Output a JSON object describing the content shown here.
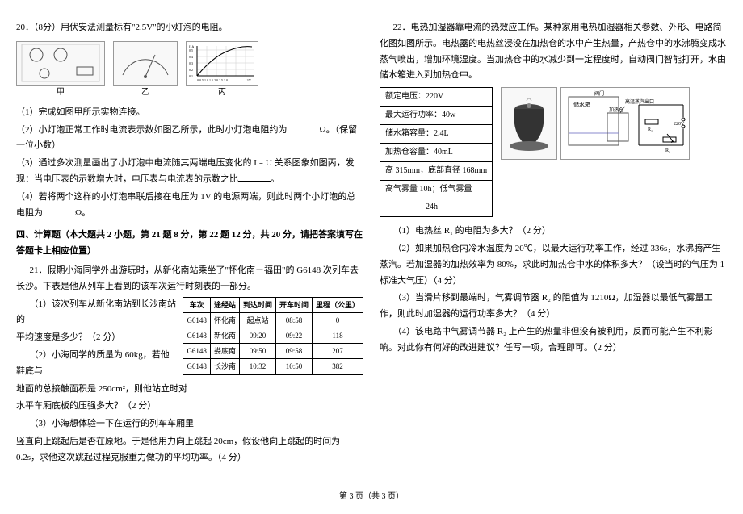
{
  "q20": {
    "title": "20．（8分）用伏安法测量标有\"2.5V\"的小灯泡的电阻。",
    "fig_labels": [
      "甲",
      "乙",
      "丙"
    ],
    "s1": "（1）完成如图甲所示实物连接。",
    "s2": "（2）小灯泡正常工作时电流表示数如图乙所示，此时小灯泡电阻约为",
    "s2_tail": "Ω。（保留一位小数）",
    "s3": "（3）通过多次测量画出了小灯泡中电流随其两端电压变化的 I﹣U 关系图象如图丙，发现：当电压表的示数增大时，电压表与电流表的示数之比",
    "s3_tail": "。",
    "s4": "（4）若将两个这样的小灯泡串联后接在电压为 1V 的电源两端，则此时两个小灯泡的总电阻为",
    "s4_tail": "Ω。"
  },
  "section4": "四、计算题（本大题共 2 小题，第 21 题 8 分，第 22 题 12 分，共 20 分，请把答案填写在答题卡上相应位置）",
  "q21": {
    "intro": "21．假期小海同学外出游玩时，从新化南站乘坐了\"怀化南－福田\"的 G6148 次列车去长沙。下表是他从列车上看到的该车次运行时刻表的一部分。",
    "s1a": "（1）该次列车从新化南站到长沙南站的",
    "s1b": "平均速度是多少？（2 分）",
    "s2a": "（2）小海同学的质量为 60kg，若他鞋底与",
    "s2b": "地面的总接触面积是 250cm²，则他站立时对",
    "s2c": "水平车厢底板的压强多大？（2 分）",
    "s3a": "（3）小海想体验一下在运行的列车车厢里",
    "s3b": "竖直向上跳起后是否在原地。于是他用力向上跳起 20cm，假设他向上跳起的时间为 0.2s，求他这次跳起过程克服重力做功的平均功率。（4 分）",
    "table": {
      "headers": [
        "车次",
        "途经站",
        "到达时间",
        "开车时间",
        "里程（公里）"
      ],
      "rows": [
        [
          "G6148",
          "怀化南",
          "起点站",
          "08:58",
          "0"
        ],
        [
          "G6148",
          "新化南",
          "09:20",
          "09:22",
          "118"
        ],
        [
          "G6148",
          "娄底南",
          "09:50",
          "09:58",
          "207"
        ],
        [
          "G6148",
          "长沙南",
          "10:32",
          "10:50",
          "382"
        ]
      ]
    }
  },
  "q22": {
    "intro": "22．电热加湿器靠电流的热效应工作。某种家用电热加湿器相关参数、外形、电路简化图如图所示。电热器的电热丝浸没在加热仓的水中产生热量，产热仓中的水沸腾变成水蒸气喷出，增加环境湿度。当加热仓中的水减少到一定程度时，自动阀门智能打开，水由储水箱进入到加热仓中。",
    "specs": [
      "额定电压：220V",
      "最大运行功率：40w",
      "储水箱容量：2.4L",
      "加热仓容量：40mL",
      "高 315mm，底部直径 168mm",
      "高气雾量 10h；低气雾量",
      "　　　　　24h"
    ],
    "s1": "（1）电热丝 R₁ 的电阻为多大？（2 分）",
    "s2": "（2）如果加热仓内冷水温度为 20℃，以最大运行功率工作，经过 336s，水沸腾产生蒸汽。若加湿器的加热效率为 80%，求此时加热仓中水的体积多大？（设当时的气压为 1 标准大气压）（4 分）",
    "s3": "（3）当滑片移到最端时，气雾调节器 R₂ 的阻值为 1210Ω，加湿器以最低气雾量工作，则此时加湿器的运行功率多大？（4 分）",
    "s4": "（4）该电路中气雾调节器 R₂ 上产生的热量非但没有被利用，反而可能产生不利影响。对此你有何好的改进建议？任写一项，合理即可。（2 分）"
  },
  "footer": "第 3 页（共 3 页）",
  "chart_data": {
    "type": "line",
    "title": "丙",
    "xlabel": "U/V",
    "ylabel": "I/A",
    "x_ticks": [
      0,
      0.5,
      1.0,
      1.5,
      2.0,
      2.5,
      3.0
    ],
    "y_ticks": [
      0,
      0.1,
      0.2,
      0.3,
      0.4,
      0.5
    ],
    "x": [
      0,
      0.5,
      1.0,
      1.5,
      2.0,
      2.5,
      3.0
    ],
    "y": [
      0,
      0.2,
      0.3,
      0.38,
      0.44,
      0.5,
      0.52
    ],
    "xlim": [
      0,
      3.0
    ],
    "ylim": [
      0,
      0.5
    ]
  }
}
